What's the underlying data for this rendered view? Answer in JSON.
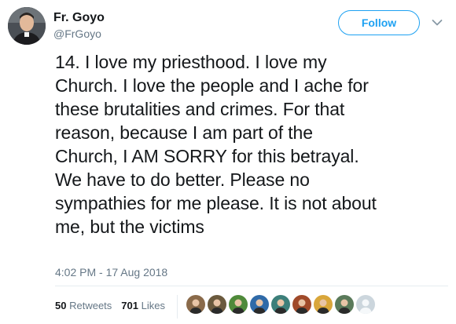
{
  "author": {
    "name": "Fr. Goyo",
    "handle": "@FrGoyo",
    "avatar_icon": "profile-photo-man"
  },
  "follow": {
    "label": "Follow",
    "color": "#1da1f2"
  },
  "menu": {
    "icon": "chevron-down-icon"
  },
  "tweet": {
    "lines": [
      "14. I love my priesthood. I love my",
      "Church. I love the people and I ache for",
      "these brutalities and crimes. For that",
      "reason, because I am part of the",
      "Church, I AM SORRY for this betrayal.",
      "We have to do better. Please no",
      "sympathies for me please. It is not about",
      "me, but the victims"
    ]
  },
  "timestamp": "4:02 PM - 17 Aug 2018",
  "stats": {
    "retweets_count": "50",
    "retweets_label": "Retweets",
    "likes_count": "701",
    "likes_label": "Likes"
  },
  "likers": [
    {
      "icon": "liker-avatar",
      "color": "#8a6a4a"
    },
    {
      "icon": "liker-avatar",
      "color": "#6b5a3e"
    },
    {
      "icon": "liker-avatar",
      "color": "#4f8a3a"
    },
    {
      "icon": "liker-avatar",
      "color": "#2f6aa8"
    },
    {
      "icon": "liker-avatar",
      "color": "#3c7f7a"
    },
    {
      "icon": "liker-avatar",
      "color": "#a04a2a"
    },
    {
      "icon": "liker-avatar",
      "color": "#d9a63a"
    },
    {
      "icon": "liker-avatar",
      "color": "#5a7a5a"
    },
    {
      "icon": "default-egg-avatar",
      "color": "#ccd6dd"
    }
  ]
}
